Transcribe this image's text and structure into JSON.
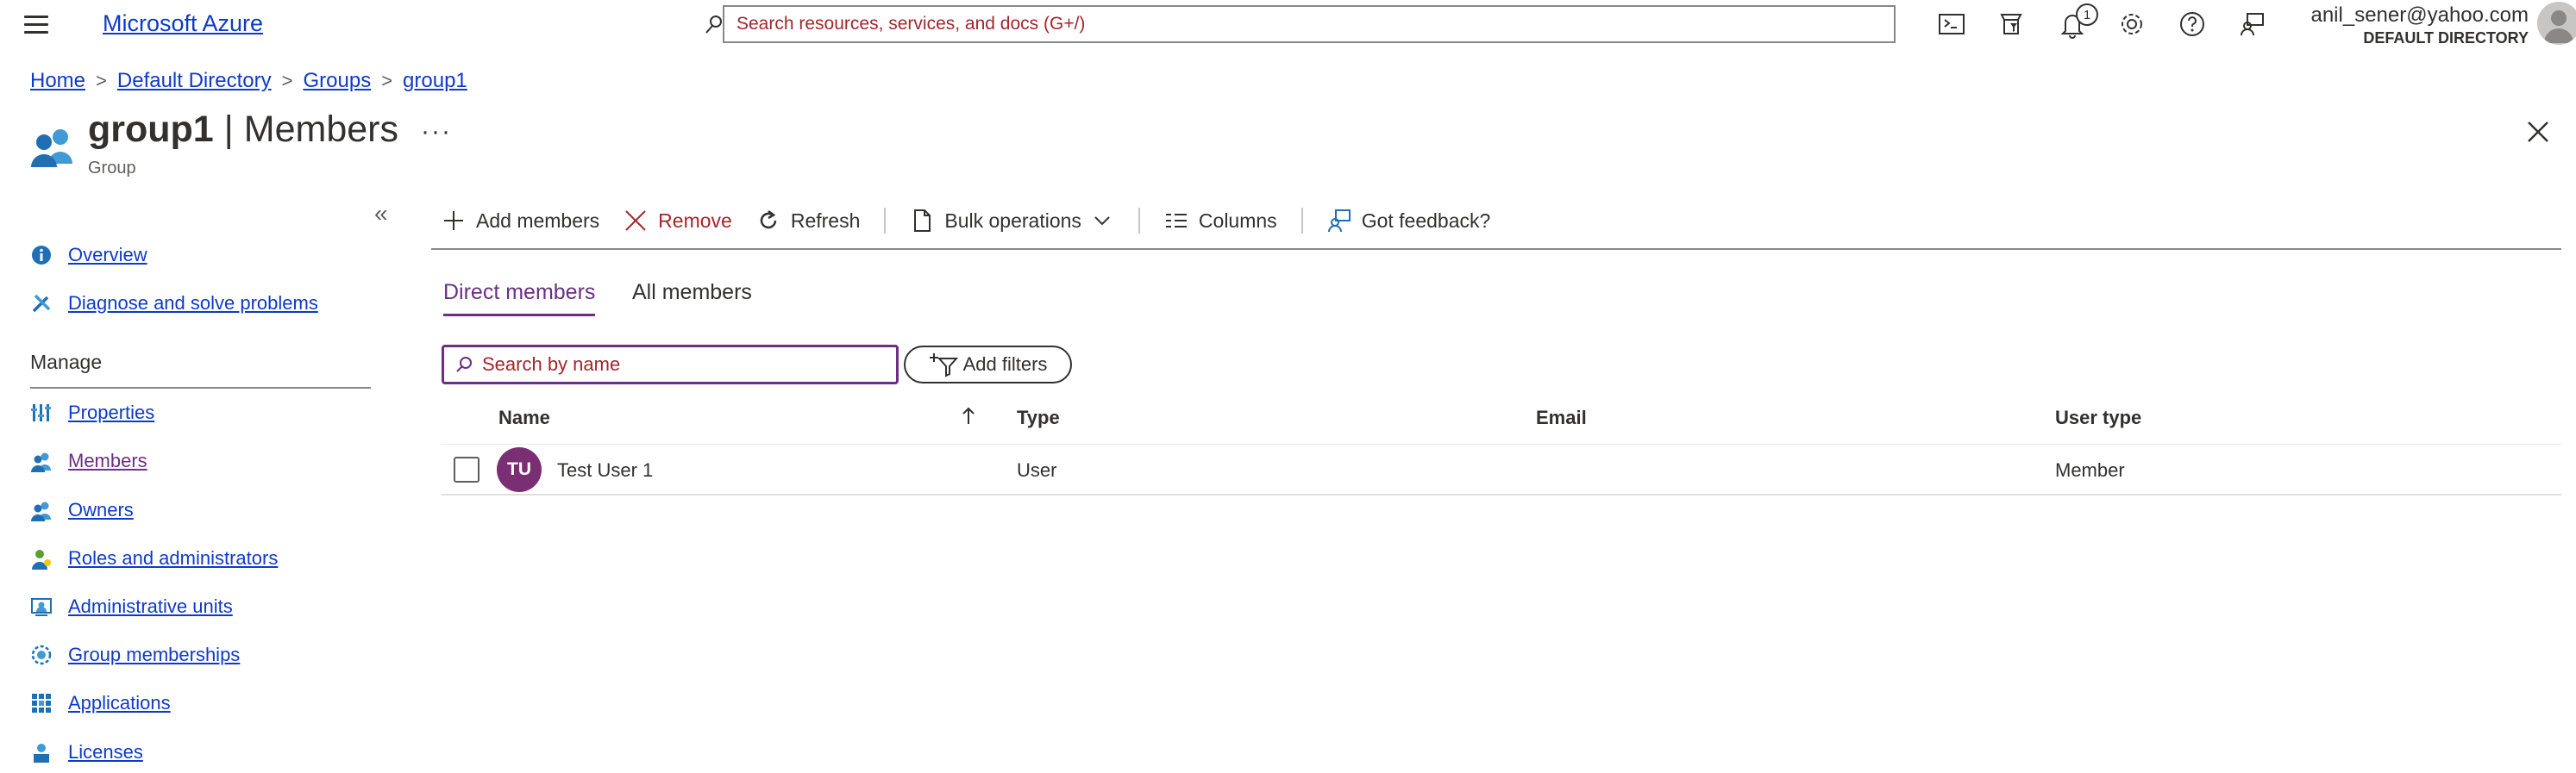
{
  "topbar": {
    "brand": "Microsoft Azure",
    "search_placeholder": "Search resources, services, and docs (G+/)",
    "notification_count": "1",
    "account_email": "anil_sener@yahoo.com",
    "account_directory": "DEFAULT DIRECTORY"
  },
  "breadcrumb": [
    "Home",
    "Default Directory",
    "Groups",
    "group1"
  ],
  "header": {
    "title_name": "group1",
    "title_section": "| Members",
    "subtitle": "Group",
    "more": "···"
  },
  "sidebar": {
    "collapse": "«",
    "top_items": [
      {
        "label": "Overview",
        "icon": "info-icon"
      },
      {
        "label": "Diagnose and solve problems",
        "icon": "wrench-icon"
      }
    ],
    "section_heading": "Manage",
    "manage_items": [
      {
        "label": "Properties",
        "icon": "properties-icon"
      },
      {
        "label": "Members",
        "icon": "members-icon"
      },
      {
        "label": "Owners",
        "icon": "owners-icon"
      },
      {
        "label": "Roles and administrators",
        "icon": "roles-icon"
      },
      {
        "label": "Administrative units",
        "icon": "admin-units-icon"
      },
      {
        "label": "Group memberships",
        "icon": "group-memberships-icon"
      },
      {
        "label": "Applications",
        "icon": "applications-icon"
      },
      {
        "label": "Licenses",
        "icon": "licenses-icon"
      }
    ]
  },
  "toolbar": {
    "add_members": "Add members",
    "remove": "Remove",
    "refresh": "Refresh",
    "bulk_operations": "Bulk operations",
    "columns": "Columns",
    "feedback": "Got feedback?"
  },
  "tabs": {
    "direct": "Direct members",
    "all": "All members"
  },
  "filters": {
    "search_placeholder": "Search by name",
    "add_filters": "Add filters"
  },
  "table": {
    "columns": [
      "Name",
      "Type",
      "Email",
      "User type"
    ],
    "rows": [
      {
        "initials": "TU",
        "name": "Test User 1",
        "type": "User",
        "email": "",
        "user_type": "Member"
      }
    ]
  },
  "colors": {
    "link": "#0e3ac9",
    "accent_purple": "#6b2f84",
    "remove_red": "#a4262c",
    "avatar": "#7a2e74",
    "text": "#323130"
  }
}
